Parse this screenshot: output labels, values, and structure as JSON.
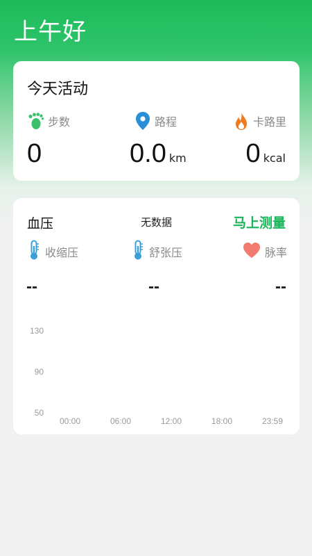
{
  "header": {
    "greeting": "上午好"
  },
  "activity": {
    "title": "今天活动",
    "steps": {
      "label": "步数",
      "value": "0",
      "icon": "footprint-icon"
    },
    "distance": {
      "label": "路程",
      "value": "0.0",
      "unit": "km",
      "icon": "location-pin-icon"
    },
    "calories": {
      "label": "卡路里",
      "value": "0",
      "unit": "kcal",
      "icon": "flame-icon"
    }
  },
  "blood_pressure": {
    "title": "血压",
    "status": "无数据",
    "measure_label": "马上测量",
    "systolic": {
      "label": "收缩压",
      "value": "--",
      "icon": "thermometer-icon"
    },
    "diastolic": {
      "label": "舒张压",
      "value": "--",
      "icon": "thermometer-icon"
    },
    "pulse": {
      "label": "脉率",
      "value": "--",
      "icon": "heart-icon"
    }
  },
  "chart_data": {
    "type": "line",
    "y_ticks": [
      "130",
      "90",
      "50"
    ],
    "x_ticks": [
      "00:00",
      "06:00",
      "12:00",
      "18:00",
      "23:59"
    ],
    "series": []
  },
  "colors": {
    "accent": "#18b55a",
    "steps_icon": "#3cc06a",
    "distance_icon": "#2a8fd8",
    "calories_icon": "#f07a1e",
    "thermometer_icon": "#3aa0d8",
    "heart_icon": "#f27a6e"
  }
}
